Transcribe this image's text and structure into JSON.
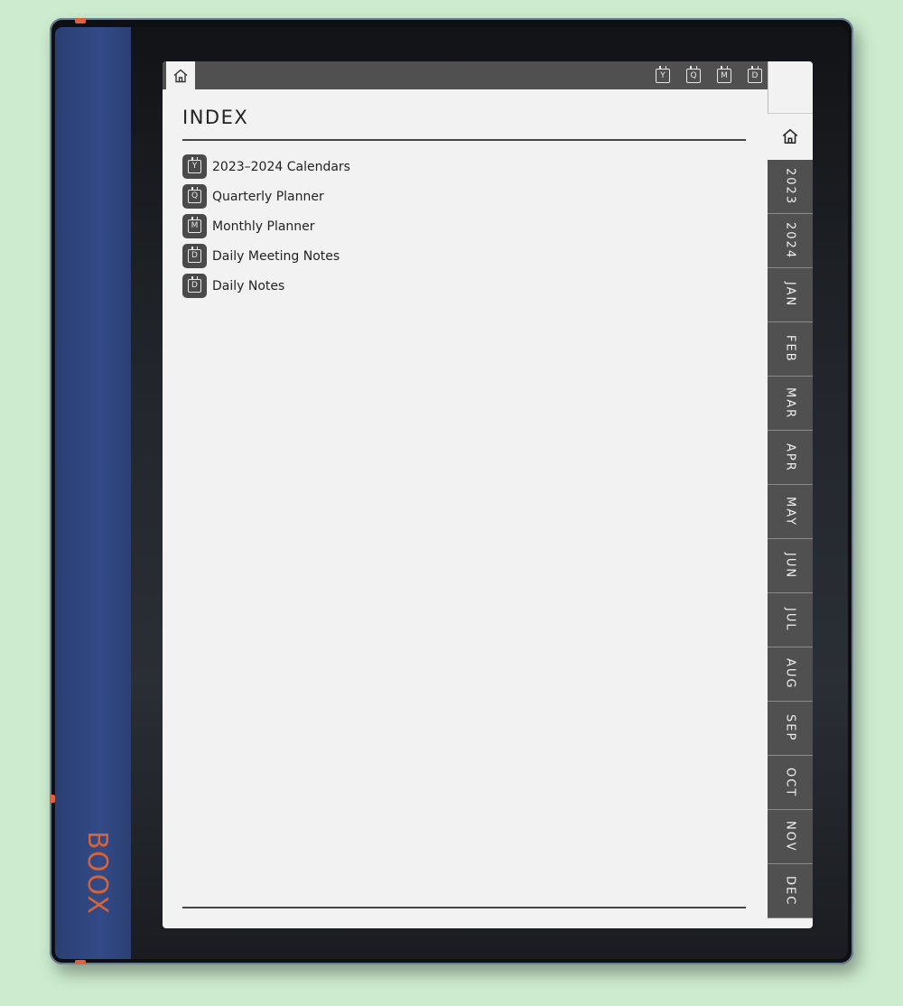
{
  "device": {
    "brand": "BOOX"
  },
  "topbar": {
    "shortcuts": [
      {
        "letter": "Y",
        "icon": "calendar-icon"
      },
      {
        "letter": "Q",
        "icon": "calendar-icon"
      },
      {
        "letter": "M",
        "icon": "calendar-icon"
      },
      {
        "letter": "D",
        "icon": "calendar-icon"
      }
    ]
  },
  "page": {
    "title": "INDEX"
  },
  "index_items": [
    {
      "letter": "Y",
      "label": "2023–2024 Calendars"
    },
    {
      "letter": "Q",
      "label": "Quarterly Planner"
    },
    {
      "letter": "M",
      "label": "Monthly Planner"
    },
    {
      "letter": "D",
      "label": "Daily Meeting Notes"
    },
    {
      "letter": "D",
      "label": "Daily Notes"
    }
  ],
  "side_tabs": [
    "2023",
    "2024",
    "JAN",
    "FEB",
    "MAR",
    "APR",
    "MAY",
    "JUN",
    "JUL",
    "AUG",
    "SEP",
    "OCT",
    "NOV",
    "DEC"
  ],
  "colors": {
    "background": "#cdeccf",
    "tab_dark": "#505050",
    "page": "#f2f2f2",
    "brand_accent": "#d2643c"
  }
}
